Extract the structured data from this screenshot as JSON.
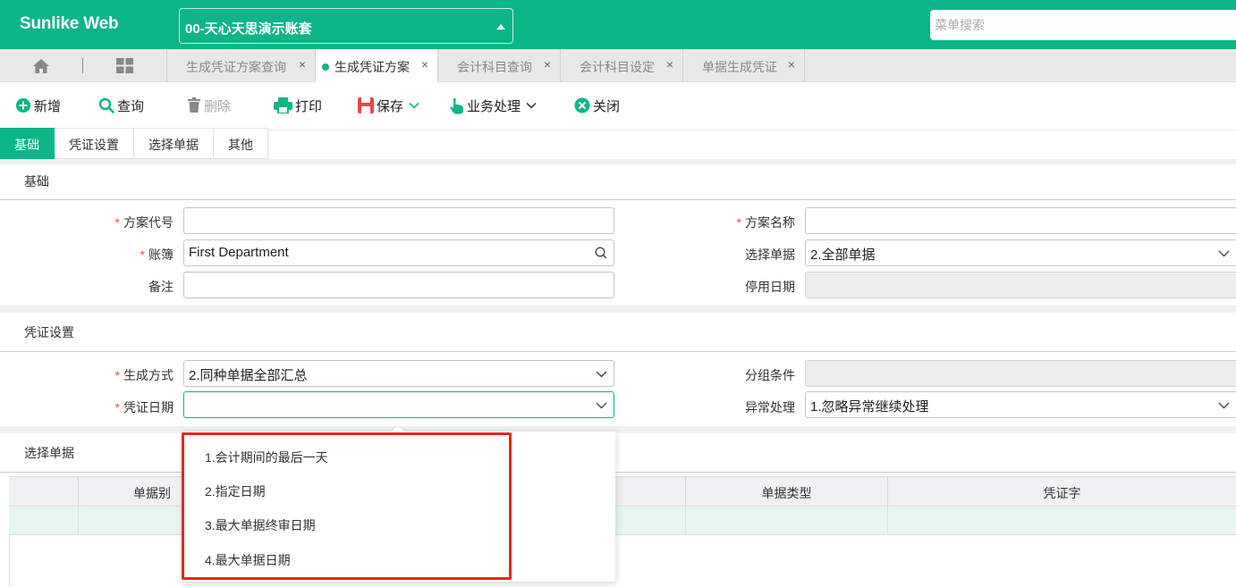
{
  "app": {
    "brand": "Sunlike Web",
    "account": "00-天心天思演示账套",
    "menu_search_placeholder": "菜单搜索"
  },
  "page_tabs": [
    {
      "label": "生成凭证方案查询",
      "active": false
    },
    {
      "label": "生成凭证方案",
      "active": true
    },
    {
      "label": "会计科目查询",
      "active": false
    },
    {
      "label": "会计科目设定",
      "active": false
    },
    {
      "label": "单据生成凭证",
      "active": false
    }
  ],
  "tab_close_glyph": "×",
  "toolbar": {
    "add": "新增",
    "query": "查询",
    "delete": "删除",
    "print": "打印",
    "save": "保存",
    "business": "业务处理",
    "close": "关闭"
  },
  "section_tabs": [
    {
      "label": "基础",
      "active": true
    },
    {
      "label": "凭证设置",
      "active": false
    },
    {
      "label": "选择单据",
      "active": false
    },
    {
      "label": "其他",
      "active": false
    }
  ],
  "required_mark": "*",
  "basic": {
    "title": "基础",
    "scheme_code_label": "方案代号",
    "scheme_code_value": "",
    "scheme_name_label": "方案名称",
    "scheme_name_value": "",
    "ledger_label": "账簿",
    "ledger_value": "First Department",
    "select_doc_label": "选择单据",
    "select_doc_value": "2.全部单据",
    "remark_label": "备注",
    "remark_value": "",
    "disable_date_label": "停用日期",
    "disable_date_value": ""
  },
  "voucher": {
    "title": "凭证设置",
    "gen_method_label": "生成方式",
    "gen_method_value": "2.同种单据全部汇总",
    "group_cond_label": "分组条件",
    "group_cond_value": "",
    "voucher_date_label": "凭证日期",
    "voucher_date_value": "",
    "exception_label": "异常处理",
    "exception_value": "1.忽略异常继续处理"
  },
  "select_docs": {
    "title": "选择单据",
    "columns": [
      "单据别",
      "单据类型",
      "凭证字"
    ]
  },
  "dropdown_options": [
    "1.会计期间的最后一天",
    "2.指定日期",
    "3.最大单据终审日期",
    "4.最大单据日期"
  ],
  "colors": {
    "brand": "#0bb588",
    "required": "#e6503c",
    "highlight_box": "#e8261b",
    "save_icon": "#e8474b"
  }
}
